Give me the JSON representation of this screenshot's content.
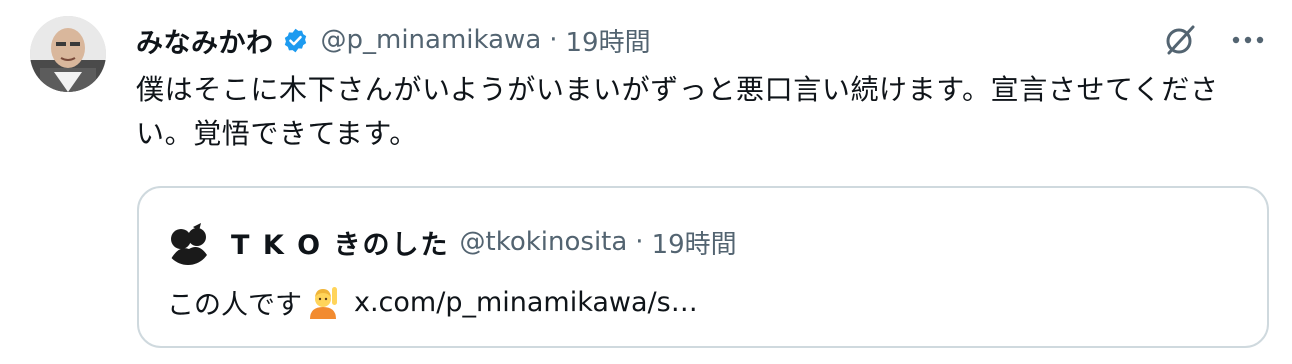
{
  "tweet": {
    "display_name": "みなみかわ",
    "handle": "@p_minamikawa",
    "separator": "·",
    "time": "19時間",
    "text": "僕はそこに木下さんがいようがいまいがずっと悪口言い続けます。宣言させてください。覚悟できてます。"
  },
  "actions": {
    "grok_icon": "grok-icon",
    "more_icon": "more-icon"
  },
  "quote": {
    "display_name": "T K O きのした",
    "handle": "@tkokinosita",
    "separator": "·",
    "time": "19時間",
    "text": "この人です",
    "emoji_name": "person-raising-hand-emoji",
    "link": "x.com/p_minamikawa/s…"
  },
  "colors": {
    "verified": "#1d9bf0",
    "secondary_text": "#536471",
    "border": "#cfd9de"
  }
}
